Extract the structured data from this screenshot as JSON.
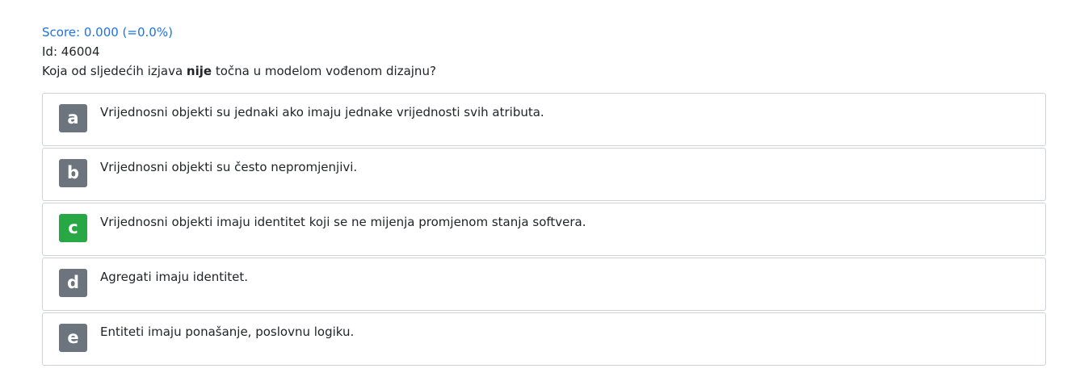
{
  "score": "Score: 0.000 (=0.0%)",
  "id_label": "Id: 46004",
  "question": {
    "before": "Koja od sljedećih izjava ",
    "bold": "nije",
    "after": " točna u modelom vođenom dizajnu?"
  },
  "colors": {
    "score": "#1a73e8",
    "badge_default": "#6c757d",
    "badge_correct": "#28a745"
  },
  "answers": [
    {
      "letter": "a",
      "text": "Vrijednosni objekti su jednaki ako imaju jednake vrijednosti svih atributa.",
      "correct": false
    },
    {
      "letter": "b",
      "text": "Vrijednosni objekti su često nepromjenjivi.",
      "correct": false
    },
    {
      "letter": "c",
      "text": "Vrijednosni objekti imaju identitet koji se ne mijenja promjenom stanja softvera.",
      "correct": true
    },
    {
      "letter": "d",
      "text": "Agregati imaju identitet.",
      "correct": false
    },
    {
      "letter": "e",
      "text": "Entiteti imaju ponašanje, poslovnu logiku.",
      "correct": false
    }
  ]
}
